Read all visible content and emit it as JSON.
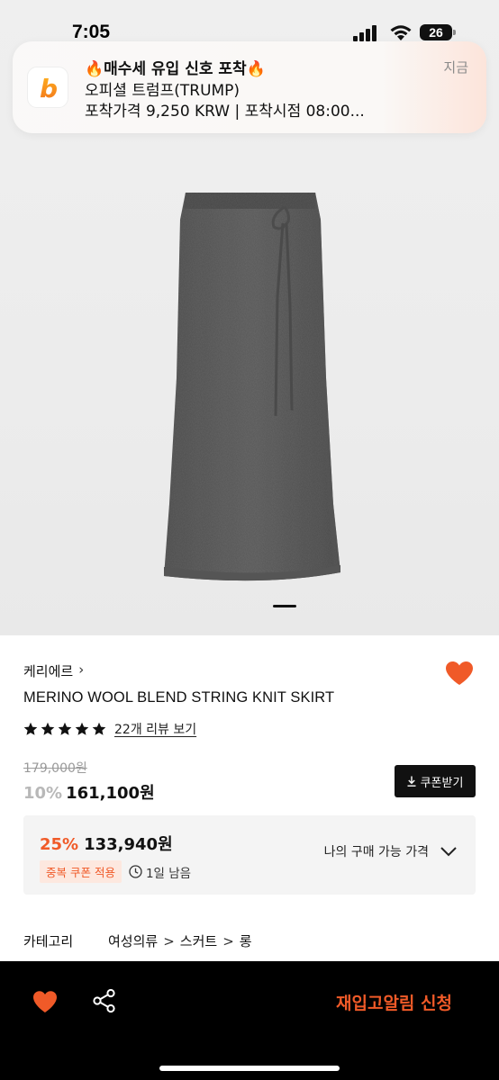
{
  "status_bar": {
    "time": "7:05",
    "battery": "26"
  },
  "notification": {
    "title": "🔥매수세 유입 신호 포착🔥",
    "line1": "오피셜 트럼프(TRUMP)",
    "line2": "포착가격 9,250 KRW | 포착시점 08:00...",
    "time": "지금",
    "app_icon_letter": "b"
  },
  "product": {
    "image_pages": 1,
    "current_page": 1,
    "brand": "케리에르",
    "brand_chevron": "›",
    "title": "MERINO WOOL BLEND STRING KNIT SKIRT",
    "rating": 5,
    "review_link": "22개 리뷰 보기",
    "original_price": "179,000원",
    "discount_rate": "10%",
    "sale_price": "161,100원",
    "coupon_button": "쿠폰받기",
    "wish_color": "#f05a28"
  },
  "benefit": {
    "rate": "25%",
    "price": "133,940원",
    "badge": "중복 쿠폰 적용",
    "time_left": "1일 남음",
    "toggle_label": "나의 구매 가능 가격"
  },
  "category": {
    "label": "카테고리",
    "path": [
      "여성의류",
      "스커트",
      "롱"
    ],
    "separator": ">"
  },
  "bottom_bar": {
    "restock_button": "재입고알림 신청",
    "accent": "#f05a28"
  },
  "icons": [
    "signal-icon",
    "wifi-icon",
    "battery-icon",
    "app-icon",
    "heart-icon",
    "star-icon",
    "download-icon",
    "clock-icon",
    "chevron-down-icon",
    "share-icon"
  ]
}
